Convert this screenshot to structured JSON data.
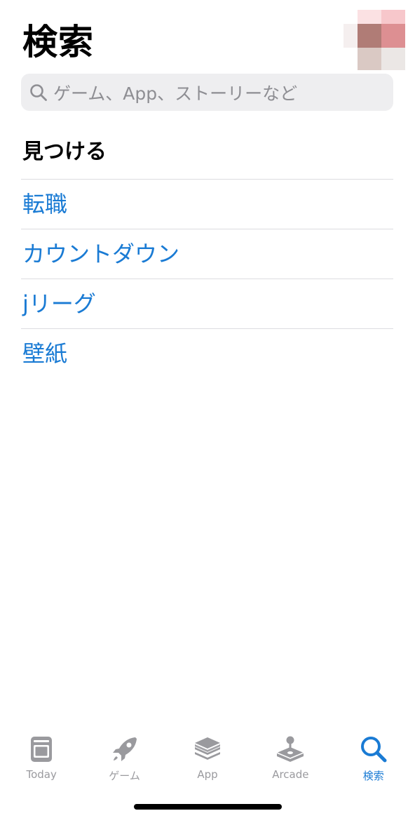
{
  "header": {
    "title": "検索"
  },
  "search": {
    "placeholder": "ゲーム、App、ストーリーなど"
  },
  "discover": {
    "title": "見つける",
    "items": [
      "転職",
      "カウントダウン",
      "jリーグ",
      "壁紙"
    ]
  },
  "tabbar": {
    "items": [
      {
        "label": "Today",
        "icon": "today-icon",
        "active": false
      },
      {
        "label": "ゲーム",
        "icon": "rocket-icon",
        "active": false
      },
      {
        "label": "App",
        "icon": "app-stack-icon",
        "active": false
      },
      {
        "label": "Arcade",
        "icon": "joystick-icon",
        "active": false
      },
      {
        "label": "検索",
        "icon": "search-icon",
        "active": true
      }
    ]
  },
  "colors": {
    "accent": "#1a7bd4",
    "inactive": "#9a9a9e",
    "search_bg": "#eeeef0"
  }
}
